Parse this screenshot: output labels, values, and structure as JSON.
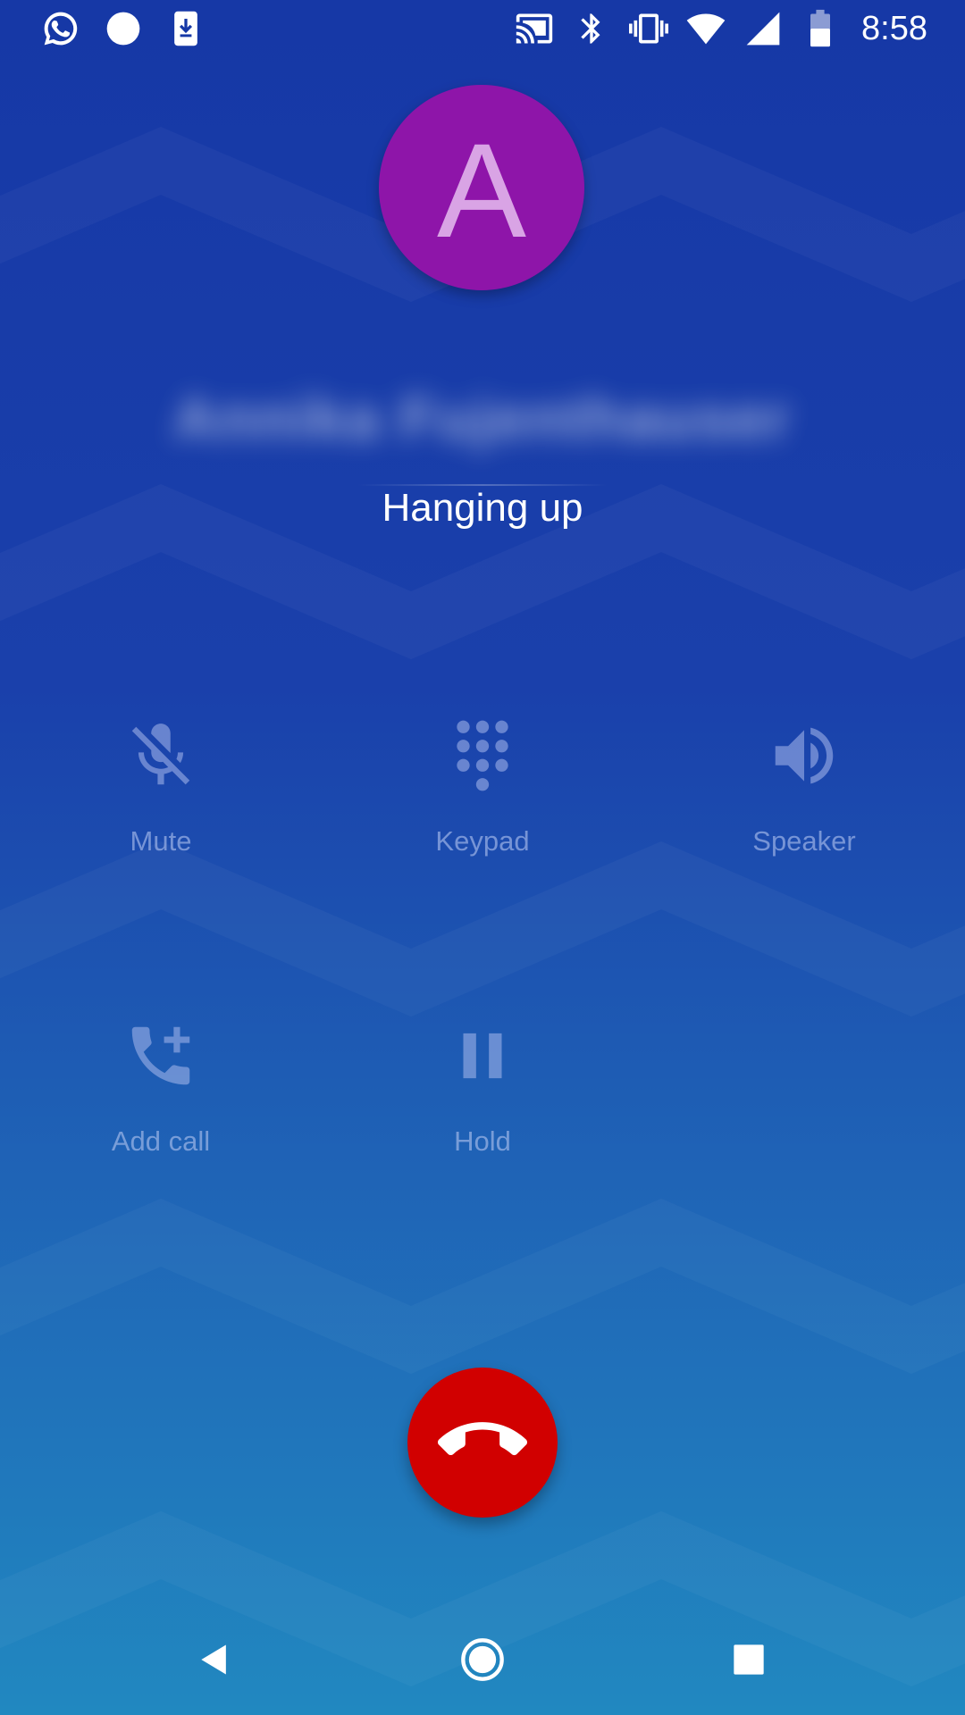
{
  "status_bar": {
    "time": "8:58",
    "left_icons": [
      "whatsapp-icon",
      "dot-icon",
      "download-icon"
    ],
    "right_icons": [
      "cast-icon",
      "bluetooth-icon",
      "vibrate-icon",
      "wifi-icon",
      "cell-signal-icon",
      "battery-icon"
    ]
  },
  "caller": {
    "avatar_letter": "A",
    "avatar_color": "#8e15a9",
    "name": "Annika Fujenthauser",
    "state": "Hanging up"
  },
  "controls": {
    "mute": {
      "label": "Mute",
      "icon": "mic-off-icon"
    },
    "keypad": {
      "label": "Keypad",
      "icon": "dialpad-icon"
    },
    "speaker": {
      "label": "Speaker",
      "icon": "speaker-icon"
    },
    "add_call": {
      "label": "Add call",
      "icon": "add-call-icon"
    },
    "hold": {
      "label": "Hold",
      "icon": "pause-icon"
    }
  },
  "end_call": {
    "icon": "hang-up-icon",
    "color": "#d10000"
  },
  "nav_bar": {
    "icons": [
      "back-icon",
      "home-icon",
      "recents-icon"
    ]
  }
}
